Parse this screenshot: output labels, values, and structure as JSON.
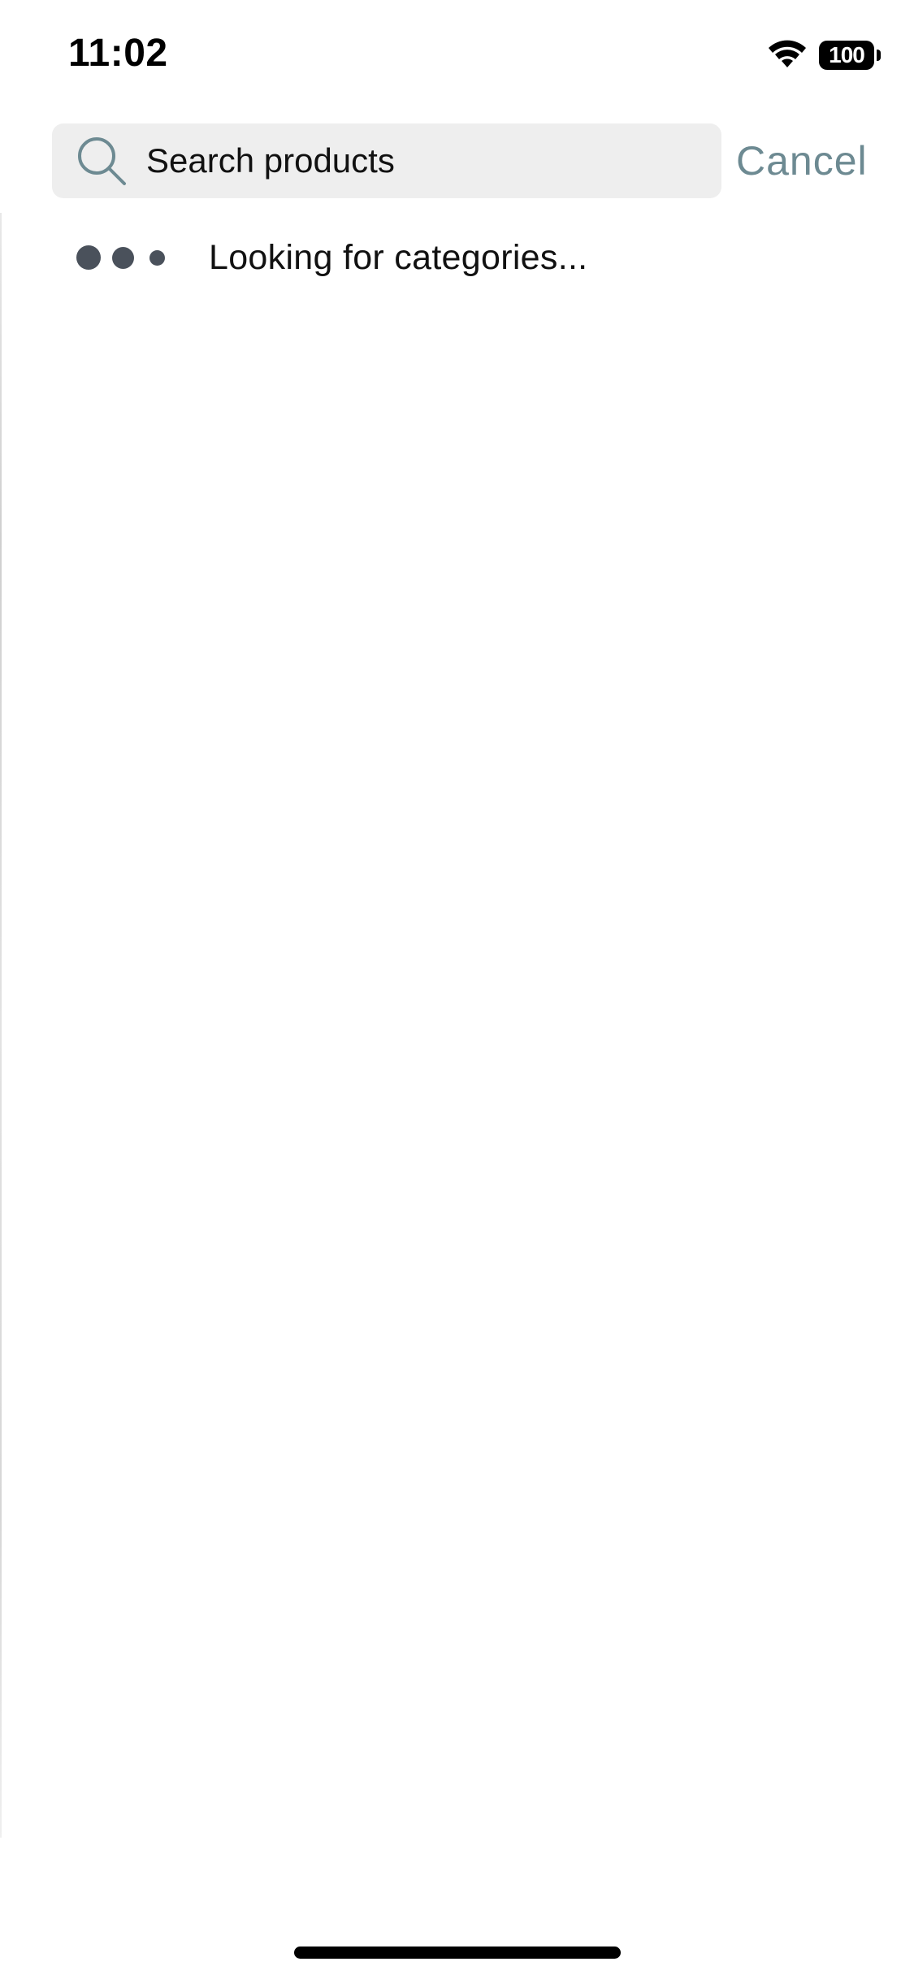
{
  "status_bar": {
    "time": "11:02",
    "battery_level": "100",
    "wifi_icon": "wifi-icon",
    "battery_icon": "battery-icon"
  },
  "search": {
    "placeholder": "Search products",
    "value": "",
    "icon": "search-icon",
    "cancel_label": "Cancel",
    "accent_color": "#6d8a92"
  },
  "loading": {
    "icon": "loading-dots-icon",
    "message": "Looking for categories..."
  }
}
